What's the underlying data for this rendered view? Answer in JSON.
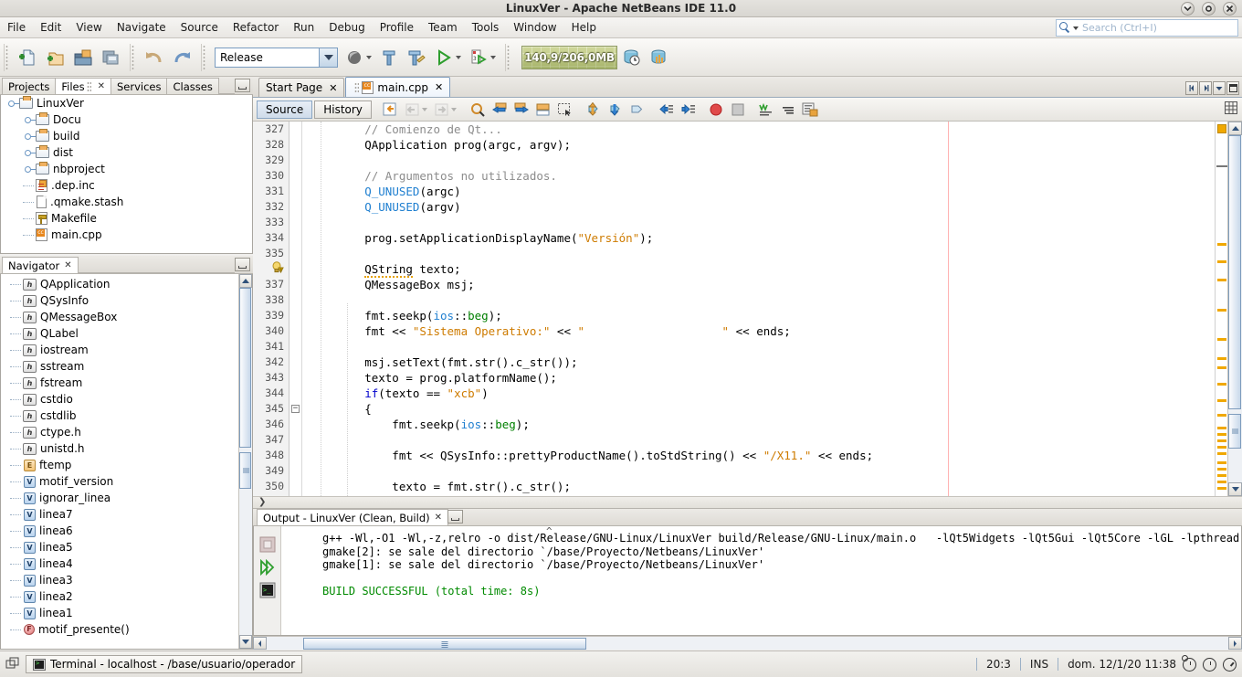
{
  "window": {
    "title": "LinuxVer - Apache NetBeans IDE 11.0",
    "minimize_icon": "chevron-down-icon",
    "maximize_icon": "circle-icon",
    "close_icon": "close-icon"
  },
  "menubar": {
    "items": [
      {
        "label": "File"
      },
      {
        "label": "Edit"
      },
      {
        "label": "View"
      },
      {
        "label": "Navigate"
      },
      {
        "label": "Source"
      },
      {
        "label": "Refactor"
      },
      {
        "label": "Run"
      },
      {
        "label": "Debug"
      },
      {
        "label": "Profile"
      },
      {
        "label": "Team"
      },
      {
        "label": "Tools"
      },
      {
        "label": "Window"
      },
      {
        "label": "Help"
      }
    ],
    "search_placeholder": "Search (Ctrl+I)",
    "search_value": ""
  },
  "toolbar": {
    "buttons": [
      {
        "name": "new-file-icon"
      },
      {
        "name": "new-project-icon"
      },
      {
        "name": "open-project-icon"
      },
      {
        "name": "save-all-icon"
      },
      {
        "name": "undo-icon"
      },
      {
        "name": "redo-icon"
      }
    ],
    "configuration": "Release",
    "build_icons": [
      {
        "name": "build-project-icon"
      },
      {
        "name": "clean-and-build-icon"
      },
      {
        "name": "run-project-icon"
      },
      {
        "name": "debug-project-icon"
      }
    ],
    "memory_gauge": "140,9/206,0MB",
    "profile_icon": "profile-icon",
    "monitor_icon": "monitor-icon"
  },
  "left_panel": {
    "tabs": [
      {
        "label": "Projects",
        "active": false,
        "closable": false
      },
      {
        "label": "Files",
        "active": true,
        "closable": true
      },
      {
        "label": "Services",
        "active": false,
        "closable": false
      },
      {
        "label": "Classes",
        "active": false,
        "closable": false
      }
    ],
    "minimize_icon": "minimize-window-icon",
    "tree": [
      {
        "label": "LinuxVer",
        "depth": 0,
        "icon": "folder-icon",
        "expanded": true
      },
      {
        "label": "Docu",
        "depth": 1,
        "icon": "folder-icon",
        "expanded": false
      },
      {
        "label": "build",
        "depth": 1,
        "icon": "folder-icon",
        "expanded": false
      },
      {
        "label": "dist",
        "depth": 1,
        "icon": "folder-icon",
        "expanded": false
      },
      {
        "label": "nbproject",
        "depth": 1,
        "icon": "folder-icon",
        "expanded": false
      },
      {
        "label": ".dep.inc",
        "depth": 1,
        "icon": "dependency-file-icon"
      },
      {
        "label": ".qmake.stash",
        "depth": 1,
        "icon": "plain-file-icon"
      },
      {
        "label": "Makefile",
        "depth": 1,
        "icon": "makefile-icon"
      },
      {
        "label": "main.cpp",
        "depth": 1,
        "icon": "cpp-file-icon"
      }
    ]
  },
  "navigator": {
    "title": "Navigator",
    "close_icon": "close-icon",
    "minimize_icon": "minimize-window-icon",
    "items": [
      {
        "label": "QApplication",
        "icon": "header-icon"
      },
      {
        "label": "QSysInfo",
        "icon": "header-icon"
      },
      {
        "label": "QMessageBox",
        "icon": "header-icon"
      },
      {
        "label": "QLabel",
        "icon": "header-icon"
      },
      {
        "label": "iostream",
        "icon": "header-icon"
      },
      {
        "label": "sstream",
        "icon": "header-icon"
      },
      {
        "label": "fstream",
        "icon": "header-icon"
      },
      {
        "label": "cstdio",
        "icon": "header-icon"
      },
      {
        "label": "cstdlib",
        "icon": "header-icon"
      },
      {
        "label": "ctype.h",
        "icon": "header-icon"
      },
      {
        "label": "unistd.h",
        "icon": "header-icon"
      },
      {
        "label": "ftemp",
        "icon": "enum-icon"
      },
      {
        "label": "motif_version",
        "icon": "variable-icon"
      },
      {
        "label": "ignorar_linea",
        "icon": "variable-icon"
      },
      {
        "label": "linea7",
        "icon": "variable-icon"
      },
      {
        "label": "linea6",
        "icon": "variable-icon"
      },
      {
        "label": "linea5",
        "icon": "variable-icon"
      },
      {
        "label": "linea4",
        "icon": "variable-icon"
      },
      {
        "label": "linea3",
        "icon": "variable-icon"
      },
      {
        "label": "linea2",
        "icon": "variable-icon"
      },
      {
        "label": "linea1",
        "icon": "variable-icon"
      },
      {
        "label": "motif_presente()",
        "icon": "function-icon"
      }
    ]
  },
  "editor": {
    "tabs": [
      {
        "label": "Start Page",
        "active": false,
        "icon": null
      },
      {
        "label": "main.cpp",
        "active": true,
        "icon": "cpp-file-icon"
      }
    ],
    "view_buttons": [
      {
        "label": "Source",
        "selected": true
      },
      {
        "label": "History",
        "selected": false
      }
    ],
    "toolbar_icons": [
      {
        "name": "last-edit-icon"
      },
      {
        "name": "back-icon"
      },
      {
        "name": "forward-icon"
      },
      {
        "name": "find-selection-icon"
      },
      {
        "name": "previous-occurrence-icon"
      },
      {
        "name": "next-occurrence-icon"
      },
      {
        "name": "toggle-highlight-icon"
      },
      {
        "name": "rectangular-selection-icon"
      },
      {
        "name": "previous-bookmark-icon"
      },
      {
        "name": "next-bookmark-icon"
      },
      {
        "name": "toggle-bookmark-icon"
      },
      {
        "name": "shift-left-icon"
      },
      {
        "name": "shift-right-icon"
      },
      {
        "name": "toggle-breakpoint-icon"
      },
      {
        "name": "stop-icon"
      },
      {
        "name": "comment-icon"
      },
      {
        "name": "uncomment-icon"
      },
      {
        "name": "format-icon"
      },
      {
        "name": "grid-icon"
      }
    ],
    "tab_nav_icons": [
      {
        "name": "scroll-tabs-left-icon"
      },
      {
        "name": "scroll-tabs-right-icon"
      },
      {
        "name": "tab-list-icon"
      },
      {
        "name": "maximize-window-icon"
      }
    ],
    "first_line": 327,
    "lines": [
      {
        "num": 327,
        "warning": false,
        "tokens": [
          {
            "t": "        // Comienzo de Qt...",
            "c": "c-comment"
          }
        ]
      },
      {
        "num": 328,
        "warning": false,
        "tokens": [
          {
            "t": "        QApplication prog(argc, argv);",
            "c": "c-plain"
          }
        ]
      },
      {
        "num": 329,
        "warning": false,
        "tokens": []
      },
      {
        "num": 330,
        "warning": false,
        "tokens": [
          {
            "t": "        // Argumentos no utilizados.",
            "c": "c-comment"
          }
        ]
      },
      {
        "num": 331,
        "warning": false,
        "tokens": [
          {
            "t": "        ",
            "c": "c-plain"
          },
          {
            "t": "Q_UNUSED",
            "c": "c-type"
          },
          {
            "t": "(argc)",
            "c": "c-plain"
          }
        ]
      },
      {
        "num": 332,
        "warning": false,
        "tokens": [
          {
            "t": "        ",
            "c": "c-plain"
          },
          {
            "t": "Q_UNUSED",
            "c": "c-type"
          },
          {
            "t": "(argv)",
            "c": "c-plain"
          }
        ]
      },
      {
        "num": 333,
        "warning": false,
        "tokens": []
      },
      {
        "num": 334,
        "warning": false,
        "tokens": [
          {
            "t": "        prog.setApplicationDisplayName(",
            "c": "c-plain"
          },
          {
            "t": "\"Versión\"",
            "c": "c-str"
          },
          {
            "t": ");",
            "c": "c-plain"
          }
        ]
      },
      {
        "num": 335,
        "warning": false,
        "tokens": []
      },
      {
        "num": 336,
        "warning": true,
        "tokens": [
          {
            "t": "        ",
            "c": "c-plain"
          },
          {
            "t": "QString",
            "c": "c-plain squig"
          },
          {
            "t": " texto;",
            "c": "c-plain"
          }
        ]
      },
      {
        "num": 337,
        "warning": false,
        "tokens": [
          {
            "t": "        QMessageBox msj;",
            "c": "c-plain"
          }
        ]
      },
      {
        "num": 338,
        "warning": false,
        "tokens": []
      },
      {
        "num": 339,
        "warning": false,
        "tokens": [
          {
            "t": "        fmt.seekp(",
            "c": "c-plain"
          },
          {
            "t": "ios",
            "c": "c-type"
          },
          {
            "t": "::",
            "c": "c-plain"
          },
          {
            "t": "beg",
            "c": "c-green"
          },
          {
            "t": ");",
            "c": "c-plain"
          }
        ]
      },
      {
        "num": 340,
        "warning": false,
        "tokens": [
          {
            "t": "        fmt << ",
            "c": "c-plain"
          },
          {
            "t": "\"Sistema Operativo:\"",
            "c": "c-str"
          },
          {
            "t": " << ",
            "c": "c-plain"
          },
          {
            "t": "\"                    \"",
            "c": "c-str"
          },
          {
            "t": " << ends;",
            "c": "c-plain"
          }
        ]
      },
      {
        "num": 341,
        "warning": false,
        "tokens": []
      },
      {
        "num": 342,
        "warning": false,
        "tokens": [
          {
            "t": "        msj.setText(fmt.str().c_str());",
            "c": "c-plain"
          }
        ]
      },
      {
        "num": 343,
        "warning": false,
        "tokens": [
          {
            "t": "        texto = prog.platformName();",
            "c": "c-plain"
          }
        ]
      },
      {
        "num": 344,
        "warning": false,
        "tokens": [
          {
            "t": "        ",
            "c": "c-plain"
          },
          {
            "t": "if",
            "c": "c-kw"
          },
          {
            "t": "(texto == ",
            "c": "c-plain"
          },
          {
            "t": "\"xcb\"",
            "c": "c-str"
          },
          {
            "t": ")",
            "c": "c-plain"
          }
        ]
      },
      {
        "num": 345,
        "warning": false,
        "fold": true,
        "tokens": [
          {
            "t": "        {",
            "c": "c-plain"
          }
        ]
      },
      {
        "num": 346,
        "warning": false,
        "tokens": [
          {
            "t": "            fmt.seekp(",
            "c": "c-plain"
          },
          {
            "t": "ios",
            "c": "c-type"
          },
          {
            "t": "::",
            "c": "c-plain"
          },
          {
            "t": "beg",
            "c": "c-green"
          },
          {
            "t": ");",
            "c": "c-plain"
          }
        ]
      },
      {
        "num": 347,
        "warning": false,
        "tokens": []
      },
      {
        "num": 348,
        "warning": false,
        "tokens": [
          {
            "t": "            fmt << QSysInfo::prettyProductName().toStdString() << ",
            "c": "c-plain"
          },
          {
            "t": "\"/X11.\"",
            "c": "c-str"
          },
          {
            "t": " << ends;",
            "c": "c-plain"
          }
        ]
      },
      {
        "num": 349,
        "warning": false,
        "tokens": []
      },
      {
        "num": 350,
        "warning": false,
        "tokens": [
          {
            "t": "            texto = fmt.str().c_str();",
            "c": "c-plain"
          }
        ]
      }
    ]
  },
  "output": {
    "title": "Output - LinuxVer (Clean, Build)",
    "close_icon": "close-icon",
    "maximize_icon": "maximize-window-icon",
    "tool_icons": [
      {
        "name": "stop-icon"
      },
      {
        "name": "rerun-icon"
      },
      {
        "name": "terminal-icon"
      }
    ],
    "lines": [
      {
        "text": "g++ -Wl,-O1 -Wl,-z,relro -o dist/Release/GNU-Linux/LinuxVer build/Release/GNU-Linux/main.o   -lQt5Widgets -lQt5Gui -lQt5Core -lGL -lpthread",
        "ok": false
      },
      {
        "text": "gmake[2]: se sale del directorio `/base/Proyecto/Netbeans/LinuxVer'",
        "ok": false
      },
      {
        "text": "gmake[1]: se sale del directorio `/base/Proyecto/Netbeans/LinuxVer'",
        "ok": false
      },
      {
        "text": "",
        "ok": false
      },
      {
        "text": "BUILD SUCCESSFUL (total time: 8s)",
        "ok": true
      }
    ]
  },
  "statusbar": {
    "window_icon": "windows-list-icon",
    "terminal_button": "Terminal - localhost - /base/usuario/operador",
    "terminal_icon": "terminal-icon",
    "cursor_position": "20:3",
    "insert_mode": "INS",
    "datetime": "dom. 12/1/20 11:38",
    "icons": [
      {
        "name": "alarm-clock-icon"
      },
      {
        "name": "clock-icon"
      },
      {
        "name": "timer-icon"
      }
    ]
  },
  "colors": {
    "accent": "#f0a800",
    "success": "#008a00",
    "string": "#ce7b00",
    "keyword": "#0000cc",
    "type": "#1f7fd0"
  }
}
